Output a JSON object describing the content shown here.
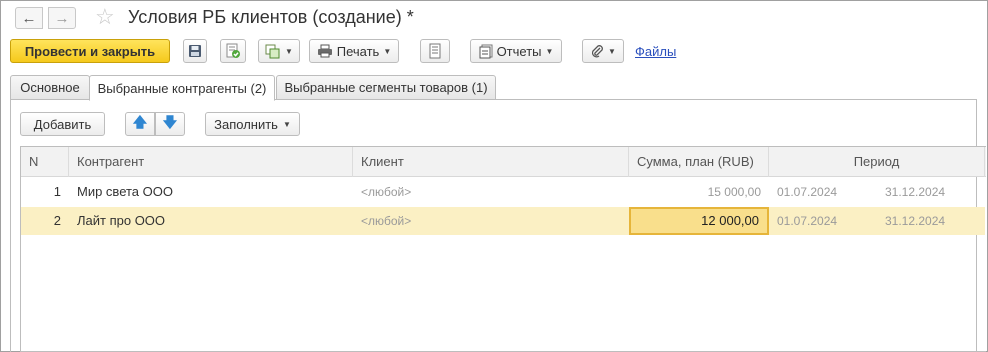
{
  "window": {
    "title": "Условия РБ клиентов (создание) *"
  },
  "nav": {
    "back_icon": "arrow-left-icon",
    "forward_icon": "arrow-right-icon",
    "star_icon": "star-icon"
  },
  "toolbar": {
    "post_and_close": "Провести и закрыть",
    "print": "Печать",
    "reports": "Отчеты",
    "files": "Файлы"
  },
  "tabs": [
    {
      "label": "Основное",
      "active": false
    },
    {
      "label": "Выбранные контрагенты (2)",
      "active": true
    },
    {
      "label": "Выбранные сегменты товаров (1)",
      "active": false
    }
  ],
  "table_toolbar": {
    "add": "Добавить",
    "fill": "Заполнить"
  },
  "table": {
    "columns": [
      "N",
      "Контрагент",
      "Клиент",
      "Сумма, план (RUB)",
      "Период"
    ],
    "rows": [
      {
        "n": "1",
        "counterparty": "Мир света ООО",
        "client": "<любой>",
        "sum": "15 000,00",
        "period_from": "01.07.2024",
        "period_to": "31.12.2024",
        "selected": false
      },
      {
        "n": "2",
        "counterparty": "Лайт про ООО",
        "client": "<любой>",
        "sum": "12 000,00",
        "period_from": "01.07.2024",
        "period_to": "31.12.2024",
        "selected": true
      }
    ]
  },
  "colors": {
    "primary_button": "#f5c91c",
    "selected_row": "#fbf0c4",
    "active_cell": "#f9df8c",
    "link": "#2a4fbd"
  }
}
